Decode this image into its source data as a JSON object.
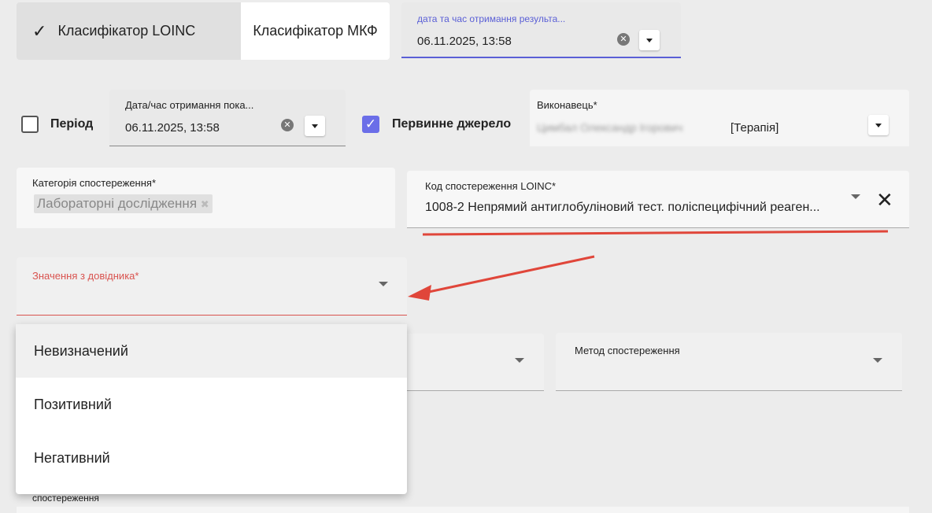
{
  "classifier": {
    "loinc_label": "Класифікатор LOINC",
    "icf_label": "Класифікатор МКФ"
  },
  "result_datetime": {
    "label": "дата та час отримання результа...",
    "value": "06.11.2025, 13:58"
  },
  "period": {
    "label": "Період",
    "checked": false
  },
  "indicator_datetime": {
    "label": "Дата/час отримання пока...",
    "value": "06.11.2025, 13:58"
  },
  "primary_source": {
    "label": "Первинне джерело",
    "checked": true
  },
  "performer": {
    "label": "Виконавець*",
    "name_blurred": "Цимбал Олександр Ігорович",
    "department": "[Терапія]"
  },
  "observation_category": {
    "label": "Категорія спостереження*",
    "chip": "Лабораторні дослідження"
  },
  "loinc_code": {
    "label": "Код спостереження LOINC*",
    "value": "1008-2  Непрямий антиглобуліновий тест. поліспецифічний реаген..."
  },
  "reference_value": {
    "label": "Значення з довідника*"
  },
  "method": {
    "label": "Метод спостереження"
  },
  "dropdown_options": [
    "Невизначений",
    "Позитивний",
    "Негативний"
  ],
  "bottom_label": "спостереження",
  "colors": {
    "accent": "#6b6ee8",
    "error": "#d9534f",
    "annotation": "#e0463a"
  }
}
